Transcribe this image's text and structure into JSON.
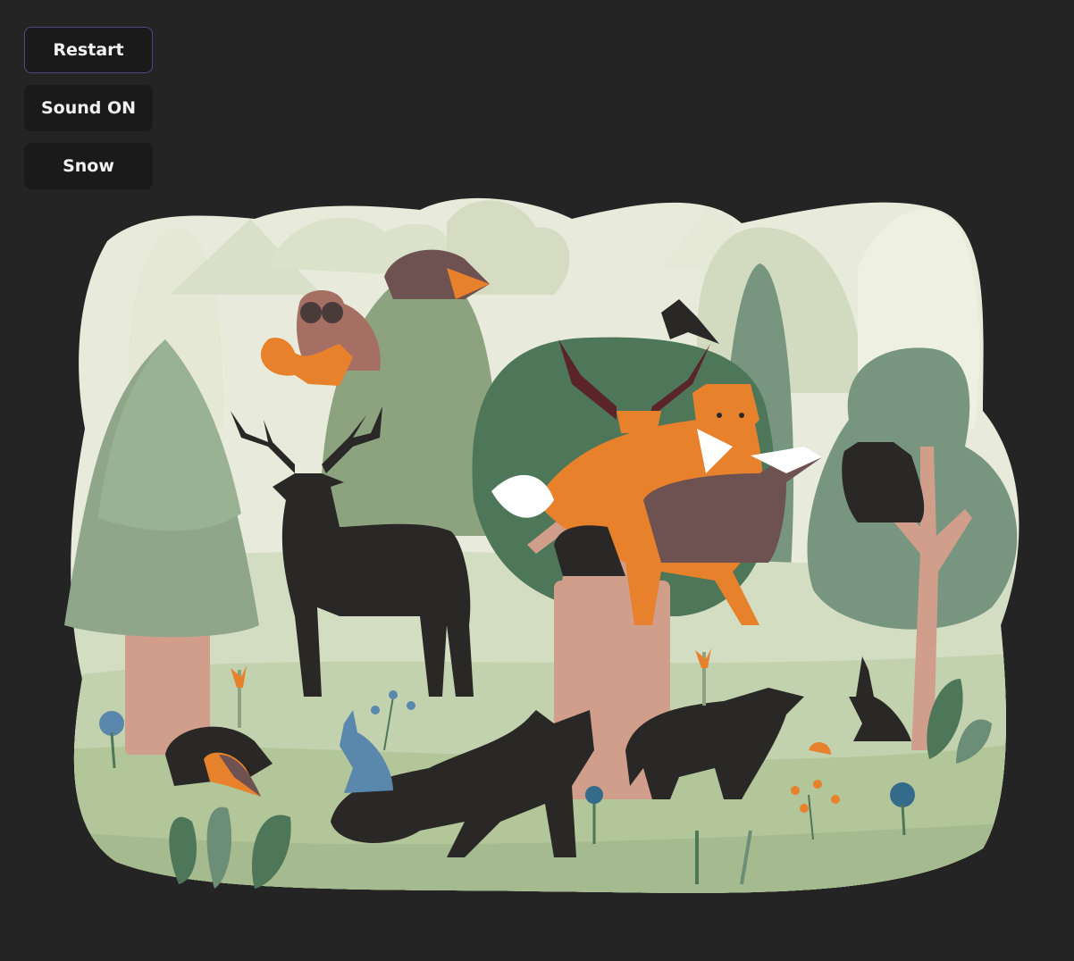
{
  "controls": {
    "restart_label": "Restart",
    "sound_label": "Sound ON",
    "snow_label": "Snow"
  },
  "colors": {
    "page_background": "#242424",
    "button_background": "#1a1a1a",
    "focus_border": "#4a4a8a",
    "scene_pale": "#e8ebdb",
    "scene_sage": "#8da27e",
    "tree_dark_green": "#4e7659",
    "trunk_pink": "#d19e8c",
    "fox_orange": "#e8812b",
    "silhouette": "#2a2827"
  },
  "scene": {
    "animals": [
      "deer",
      "fox",
      "badger",
      "bear",
      "wolf",
      "owl",
      "squirrel",
      "hedgehog",
      "rabbit",
      "robin",
      "crow",
      "elk"
    ]
  }
}
